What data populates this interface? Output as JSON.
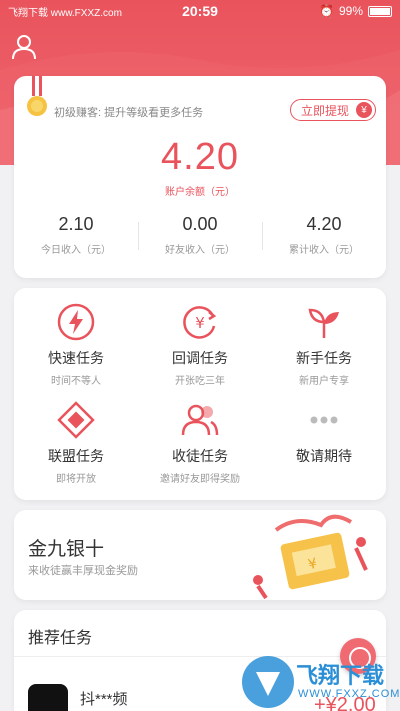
{
  "status_bar": {
    "carrier": "飞翔下载 www.FXXZ.com",
    "time": "20:59",
    "battery": "99%"
  },
  "balance": {
    "level_text": "初级赚客: 提升等级看更多任务",
    "withdraw_label": "立即提现",
    "withdraw_icon": "¥",
    "amount": "4.20",
    "amount_label": "账户余额（元）",
    "stats": [
      {
        "value": "2.10",
        "label": "今日收入（元）"
      },
      {
        "value": "0.00",
        "label": "好友收入（元）"
      },
      {
        "value": "4.20",
        "label": "累计收入（元）"
      }
    ]
  },
  "tasks": [
    {
      "title": "快速任务",
      "subtitle": "时间不等人",
      "icon": "lightning-icon"
    },
    {
      "title": "回调任务",
      "subtitle": "开张吃三年",
      "icon": "yen-refresh-icon"
    },
    {
      "title": "新手任务",
      "subtitle": "新用户专享",
      "icon": "sprout-icon"
    },
    {
      "title": "联盟任务",
      "subtitle": "即将开放",
      "icon": "diamond-icon"
    },
    {
      "title": "收徒任务",
      "subtitle": "邀请好友即得奖励",
      "icon": "people-icon"
    },
    {
      "title": "敬请期待",
      "subtitle": "",
      "icon": "more-dots-icon"
    }
  ],
  "promo": {
    "title": "金九银十",
    "subtitle": "来收徒赢丰厚现金奖励"
  },
  "recommend": {
    "title": "推荐任务",
    "items": [
      {
        "name": "抖***频",
        "reward": "+¥2.00"
      }
    ]
  },
  "watermark": {
    "brand": "飞翔下载",
    "url": "WWW.FXXZ.COM"
  },
  "colors": {
    "accent": "#e9535c"
  }
}
